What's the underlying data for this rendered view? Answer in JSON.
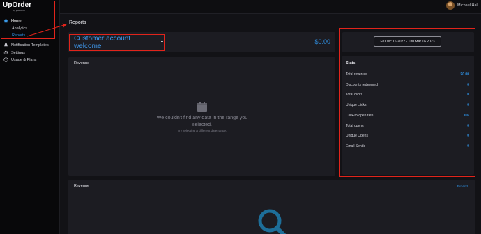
{
  "topbar": {
    "user_name": "Michael Hall"
  },
  "sidebar": {
    "logo": "UpOrder",
    "logo_sub": "by jeesbo.co",
    "items": [
      {
        "label": "Home",
        "icon": "home-icon"
      },
      {
        "label": "Analytics"
      },
      {
        "label": "Reports"
      },
      {
        "label": "Notification Templates",
        "icon": "bell-icon"
      },
      {
        "label": "Settings",
        "icon": "gear-icon"
      },
      {
        "label": "Usage & Plans",
        "icon": "gauge-icon"
      }
    ]
  },
  "main": {
    "page_title": "Reports",
    "campaign": {
      "selected": "Customer account welcome",
      "total": "$0.00"
    },
    "revenue_card": {
      "title": "Revenue",
      "empty_title": "We couldn't find any data in the range you selected.",
      "empty_sub": "Try selecting a different date range."
    },
    "date_range": "Fri Dec 16 2022 - Thu Mar 16 2023",
    "stats": {
      "title": "Stats",
      "rows": [
        {
          "label": "Total revenue",
          "value": "$0.00"
        },
        {
          "label": "Discounts redeemed",
          "value": "0"
        },
        {
          "label": "Total clicks",
          "value": "0"
        },
        {
          "label": "Unique clicks",
          "value": "0"
        },
        {
          "label": "Click-to-open rate",
          "value": "0%"
        },
        {
          "label": "Total opens",
          "value": "0"
        },
        {
          "label": "Unique Opens",
          "value": "0"
        },
        {
          "label": "Email Sends",
          "value": "0"
        }
      ]
    },
    "revenue2_card": {
      "title": "Revenue",
      "expand_label": "Expand"
    }
  },
  "colors": {
    "accent": "#2e8fe0",
    "annotation": "#e1241b",
    "background": "#121216",
    "card": "#1c1c22"
  }
}
